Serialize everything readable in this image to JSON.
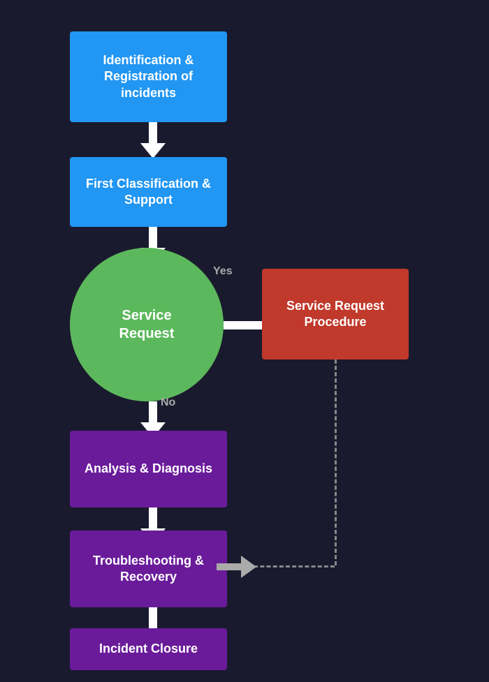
{
  "boxes": {
    "identification": "Identification & Registration of incidents",
    "classification": "First Classification & Support",
    "service_request": "Service\nRequest",
    "service_request_procedure": "Service Request Procedure",
    "analysis": "Analysis & Diagnosis",
    "troubleshooting": "Troubleshooting & Recovery",
    "incident_closure": "Incident Closure"
  },
  "labels": {
    "yes": "Yes",
    "no": "No"
  },
  "colors": {
    "blue": "#2196F3",
    "green": "#5cb85c",
    "purple": "#6A1B9A",
    "red": "#c0392b",
    "background": "#1a1a2e"
  }
}
